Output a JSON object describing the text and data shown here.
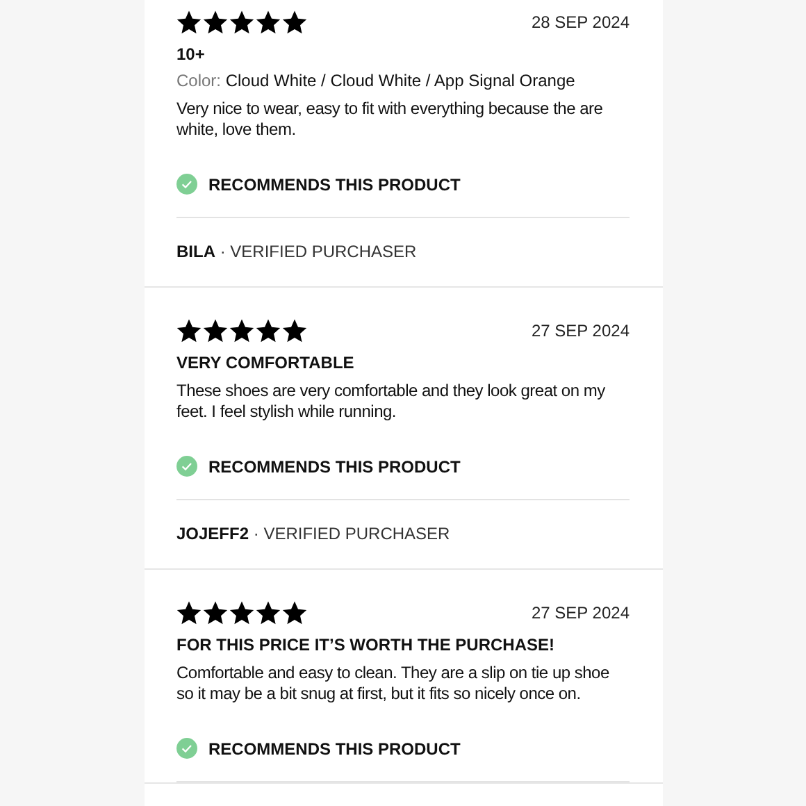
{
  "reviews": [
    {
      "stars": 5,
      "date": "28 SEP 2024",
      "title": "10+",
      "color_label": "Color:",
      "color_value": "Cloud White / Cloud White / App Signal Orange",
      "body": "Very nice to wear, easy to fit with everything because the are white, love them.",
      "recommends": true,
      "recommend_text": "RECOMMENDS THIS PRODUCT",
      "author": "BILA",
      "author_note": "· VERIFIED PURCHASER"
    },
    {
      "stars": 5,
      "date": "27 SEP 2024",
      "title": "VERY COMFORTABLE",
      "body": "These shoes are very comfortable and they look great on my feet. I feel stylish while running.",
      "recommends": true,
      "recommend_text": "RECOMMENDS THIS PRODUCT",
      "author": "JOJEFF2",
      "author_note": "· VERIFIED PURCHASER"
    },
    {
      "stars": 5,
      "date": "27 SEP 2024",
      "title": "FOR THIS PRICE IT’S WORTH THE PURCHASE!",
      "body": "Comfortable and easy to clean. They are a slip on tie up shoe so it may be a bit snug at first, but it fits so nicely once on.",
      "recommends": true,
      "recommend_text": "RECOMMENDS THIS PRODUCT"
    }
  ]
}
